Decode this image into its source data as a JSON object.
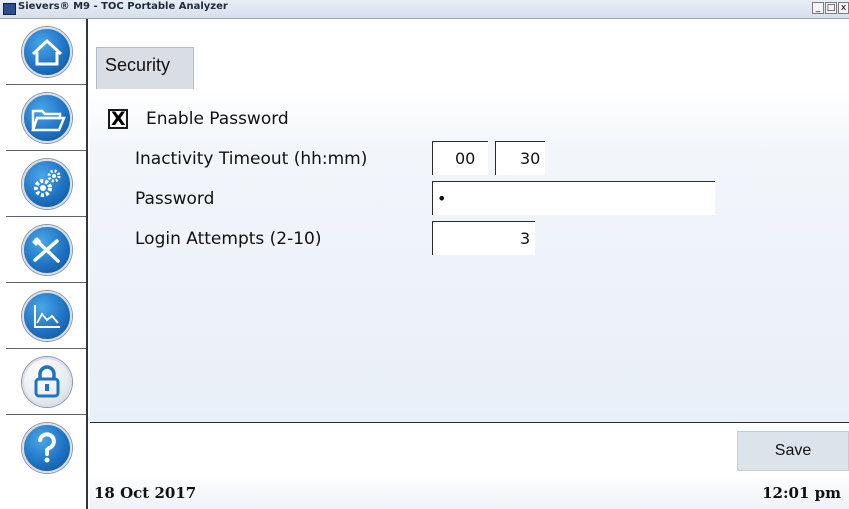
{
  "window": {
    "title": "Sievers® M9 - TOC Portable Analyzer",
    "buttons": [
      "_",
      "□",
      "x"
    ]
  },
  "sidebar": {
    "items": [
      {
        "name": "home",
        "icon": "home-icon"
      },
      {
        "name": "files",
        "icon": "folder-icon"
      },
      {
        "name": "settings",
        "icon": "gears-icon"
      },
      {
        "name": "tools",
        "icon": "tools-icon"
      },
      {
        "name": "data",
        "icon": "chart-icon"
      },
      {
        "name": "security",
        "icon": "lock-icon",
        "active": true
      },
      {
        "name": "help",
        "icon": "help-icon"
      }
    ]
  },
  "tab": {
    "label": "Security"
  },
  "form": {
    "enable_password": {
      "label": "Enable Password",
      "checked": true,
      "mark": "X"
    },
    "inactivity_timeout": {
      "label": "Inactivity Timeout (hh:mm)",
      "hours": "00",
      "minutes": "30"
    },
    "password": {
      "label": "Password",
      "value": "•"
    },
    "login_attempts": {
      "label": "Login Attempts (2-10)",
      "value": "3"
    }
  },
  "actions": {
    "save_label": "Save"
  },
  "status": {
    "date": "18 Oct 2017",
    "time": "12:01 pm"
  },
  "colors": {
    "accent": "#1f73c4",
    "panel": "#e9eff8",
    "tab": "#d9dde4"
  }
}
